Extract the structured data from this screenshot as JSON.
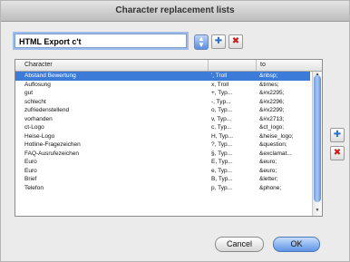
{
  "window": {
    "title": "Character replacement lists"
  },
  "list_selector": {
    "value": "HTML Export c't"
  },
  "icons": {
    "stepper": "up-down-arrows-icon",
    "add": "plus-icon",
    "remove": "x-icon"
  },
  "table": {
    "headers": [
      "Character",
      "",
      "to"
    ],
    "rows": [
      {
        "key": "Abstand Bewertung",
        "mid": "', Troll",
        "to": "&nbsp;"
      },
      {
        "key": "Auflosung",
        "mid": "x, Troll",
        "to": "&times;"
      },
      {
        "key": "gut",
        "mid": "+, Typ...",
        "to": "&#x2295;"
      },
      {
        "key": "schlecht",
        "mid": "-, Typ...",
        "to": "&#x2296;"
      },
      {
        "key": "zufriedenstellend",
        "mid": "o, Typ...",
        "to": "&#x2299;"
      },
      {
        "key": "vorhanden",
        "mid": "v, Typ...",
        "to": "&#x2713;"
      },
      {
        "key": "ct-Logo",
        "mid": "c, Typ...",
        "to": "&ct_logo;"
      },
      {
        "key": "Heise-Logo",
        "mid": "H, Typ...",
        "to": "&heise_logo;"
      },
      {
        "key": "Hotline-Fragezeichen",
        "mid": "?, Typ...",
        "to": "&question;"
      },
      {
        "key": "FAQ-Ausrufezeichen",
        "mid": "§, Typ...",
        "to": "&exclamat..."
      },
      {
        "key": "Euro",
        "mid": "E, Typ...",
        "to": "&euro;"
      },
      {
        "key": "Euro",
        "mid": "e, Typ...",
        "to": "&euro;"
      },
      {
        "key": "Brief",
        "mid": "B, Typ...",
        "to": "&letter;"
      },
      {
        "key": "Telefon",
        "mid": "p, Typ...",
        "to": "&phone;"
      }
    ]
  },
  "buttons": {
    "cancel": "Cancel",
    "ok": "OK"
  },
  "colors": {
    "selection": "#3d7bd9",
    "ok_button": "#5d94e6",
    "remove_icon": "#c71c1c",
    "add_icon": "#2d6fc9"
  }
}
